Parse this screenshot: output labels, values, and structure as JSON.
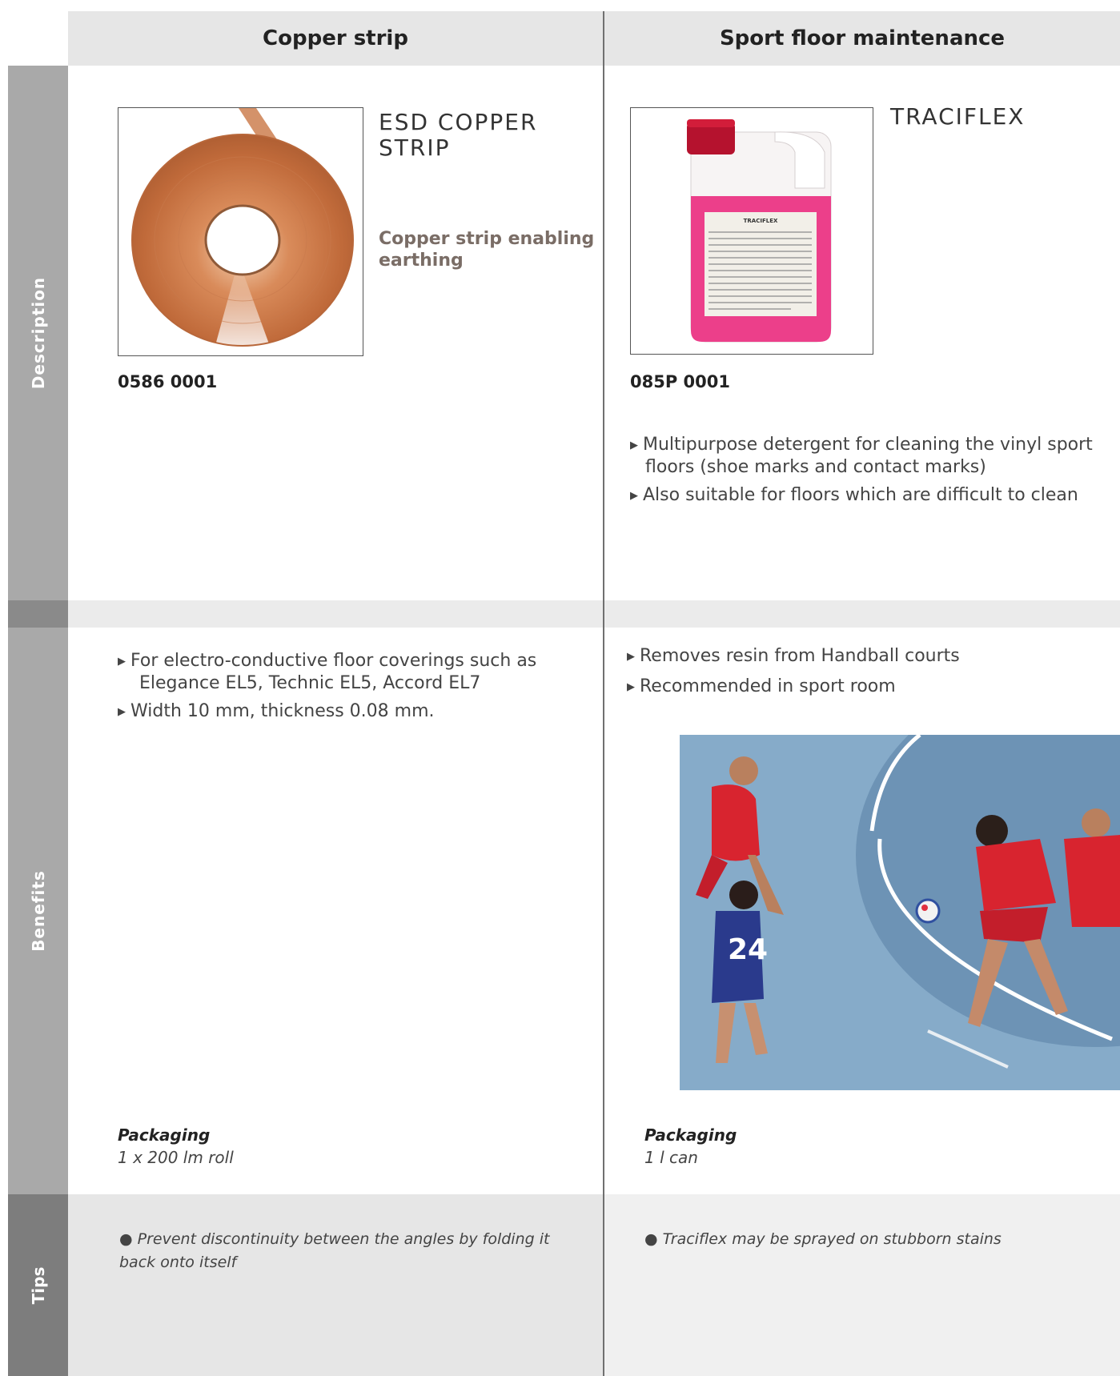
{
  "columns": {
    "left_header": "Copper strip",
    "right_header": "Sport floor maintenance"
  },
  "sidebar": {
    "description": "Description",
    "benefits": "Benefits",
    "tips": "Tips"
  },
  "left": {
    "product_title_line1": "ESD COPPER",
    "product_title_line2": "STRIP",
    "subtitle_line1": "Copper strip enabling",
    "subtitle_line2": "earthing",
    "code": "0586 0001",
    "benefits": [
      {
        "line1": "For electro-conductive floor coverings such as",
        "line2": "Elegance EL5, Technic EL5, Accord EL7"
      },
      {
        "line1": "Width 10 mm, thickness 0.08 mm.",
        "line2": ""
      }
    ],
    "packaging_label": "Packaging",
    "packaging_value": "1 x 200 lm roll",
    "tip_line1": "Prevent discontinuity between the angles by folding it",
    "tip_line2": "back onto itself"
  },
  "right": {
    "product_title": "TRACIFLEX",
    "code": "085P 0001",
    "description_bullets": [
      {
        "line1": "Multipurpose detergent for cleaning the vinyl sport",
        "line2": "floors (shoe marks and contact marks)"
      },
      {
        "line1": "Also suitable for floors which are difficult to clean",
        "line2": ""
      }
    ],
    "benefits": [
      "Removes resin from Handball courts",
      "Recommended in sport room"
    ],
    "packaging_label": "Packaging",
    "packaging_value": "1 l can",
    "tip": "Traciflex may be sprayed on stubborn stains",
    "bottle_label": "TRACIFLEX",
    "player_number": "24"
  },
  "colors": {
    "header_bg": "#e6e6e6",
    "sidebar_gray": "#a9a9a9",
    "tips_bg": "#e6e6e6",
    "copper": "#c8784a",
    "pink_liquid": "#ec3f8a",
    "court_blue": "#7fa5c4"
  },
  "icons": {
    "bullet": "triangle-right-icon",
    "tip_bullet": "dot-icon"
  }
}
